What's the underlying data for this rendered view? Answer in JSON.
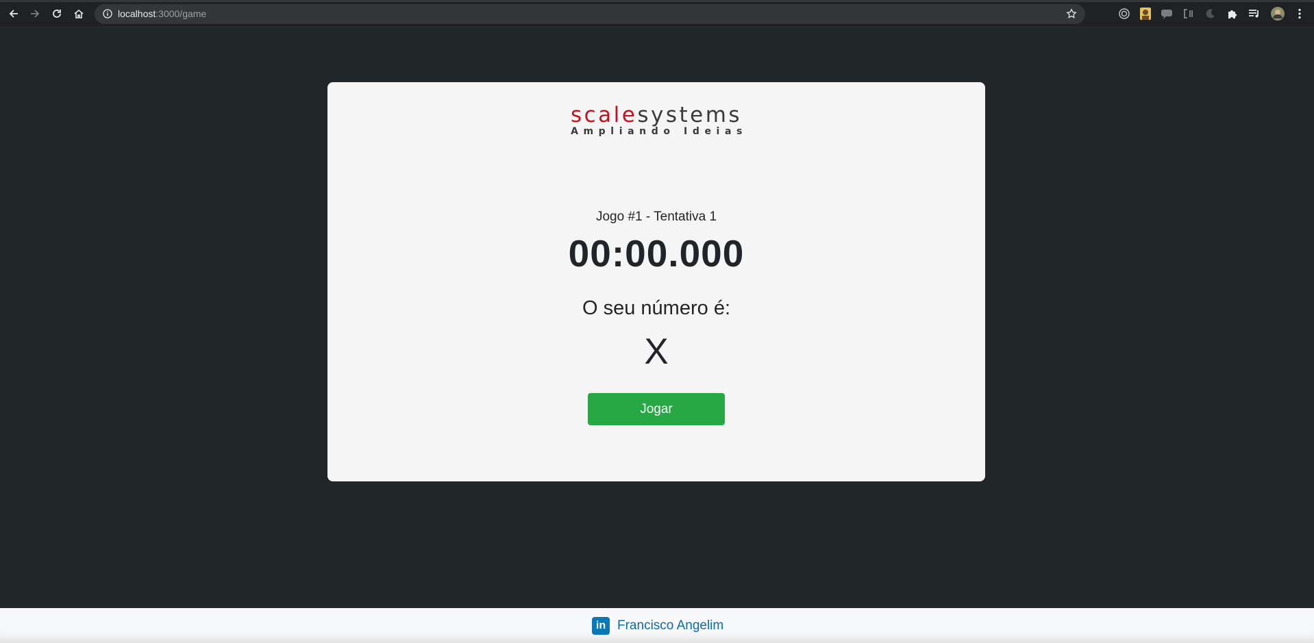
{
  "browser": {
    "url_host": "localhost",
    "url_path": ":3000/game",
    "nav": [
      "back-icon",
      "forward-icon",
      "reload-icon",
      "home-icon"
    ],
    "extensions": [
      "target-icon",
      "avatar-extension-icon",
      "chat-extension-icon",
      "code-extension-icon",
      "moon-extension-icon",
      "puzzle-icon",
      "media-queue-icon",
      "profile-avatar-icon",
      "menu-dots-icon"
    ]
  },
  "logo": {
    "part1": "scale",
    "part2": "systems",
    "tagline": "Ampliando Ideias",
    "colors": {
      "accent": "#c1121f",
      "dark": "#3a3a3a"
    }
  },
  "game": {
    "title": "Jogo #1 - Tentativa 1",
    "timer": "00:00.000",
    "number_label": "O seu número é:",
    "number_value": "X",
    "play_button": "Jogar",
    "button_color": "#28a745"
  },
  "footer": {
    "linkedin_badge": "in",
    "author": "Francisco Angelim",
    "link_color": "#0d6aa8"
  }
}
